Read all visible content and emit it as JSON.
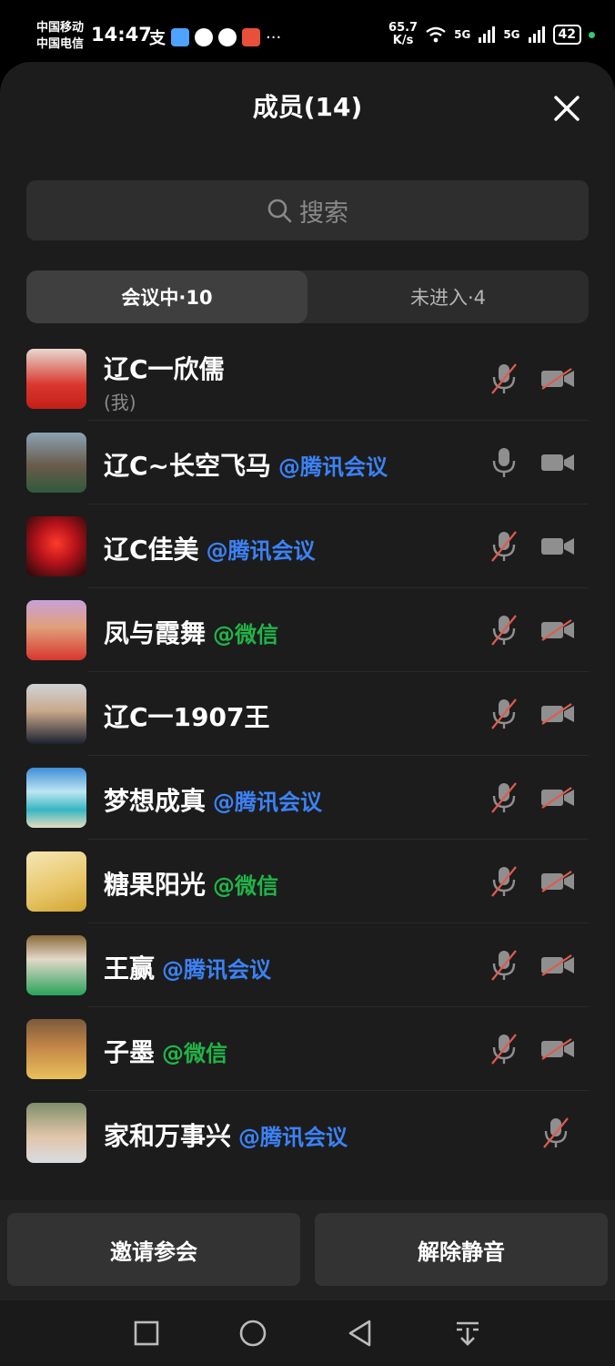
{
  "status_bar": {
    "carrier1": "中国移动",
    "carrier2": "中国电信",
    "time": "14:47",
    "net_speed_value": "65.7",
    "net_speed_unit": "K/s",
    "signal1": "5G",
    "signal2": "5G",
    "battery": "42"
  },
  "header": {
    "title": "成员(14)"
  },
  "search": {
    "placeholder": "搜索"
  },
  "tabs": [
    {
      "label": "会议中·10",
      "active": true
    },
    {
      "label": "未进入·4",
      "active": false
    }
  ],
  "members": [
    {
      "name": "辽C一欣儒",
      "sub": "(我)",
      "source": "",
      "source_type": "",
      "mic_muted": true,
      "cam_off": true,
      "cam_shown": true
    },
    {
      "name": "辽C~长空飞马",
      "source": "@腾讯会议",
      "source_type": "tencent",
      "mic_muted": false,
      "cam_off": false,
      "cam_shown": true
    },
    {
      "name": "辽C佳美",
      "source": "@腾讯会议",
      "source_type": "tencent",
      "mic_muted": true,
      "cam_off": false,
      "cam_shown": true
    },
    {
      "name": "凤与霞舞",
      "source": "@微信",
      "source_type": "wechat",
      "mic_muted": true,
      "cam_off": true,
      "cam_shown": true
    },
    {
      "name": "辽C一1907王",
      "source": "",
      "source_type": "",
      "mic_muted": true,
      "cam_off": true,
      "cam_shown": true
    },
    {
      "name": "梦想成真",
      "source": "@腾讯会议",
      "source_type": "tencent",
      "mic_muted": true,
      "cam_off": true,
      "cam_shown": true
    },
    {
      "name": "糖果阳光",
      "source": "@微信",
      "source_type": "wechat",
      "mic_muted": true,
      "cam_off": true,
      "cam_shown": true
    },
    {
      "name": "王赢",
      "source": "@腾讯会议",
      "source_type": "tencent",
      "mic_muted": true,
      "cam_off": true,
      "cam_shown": true
    },
    {
      "name": "子墨",
      "source": "@微信",
      "source_type": "wechat",
      "mic_muted": true,
      "cam_off": true,
      "cam_shown": true
    },
    {
      "name": "家和万事兴",
      "source": "@腾讯会议",
      "source_type": "tencent",
      "mic_muted": true,
      "cam_off": true,
      "cam_shown": false
    }
  ],
  "actions": {
    "invite_label": "邀请参会",
    "unmute_label": "解除静音"
  },
  "colors": {
    "tencent": "#3c82f6",
    "wechat": "#21b548",
    "muted_slash": "#e05a4e",
    "icon_gray": "#8f8f8f"
  },
  "icons": [
    "close-icon",
    "search-icon",
    "mic-icon",
    "mic-muted-icon",
    "camera-icon",
    "camera-off-icon",
    "square-icon",
    "circle-icon",
    "back-icon",
    "dropdown-icon"
  ]
}
